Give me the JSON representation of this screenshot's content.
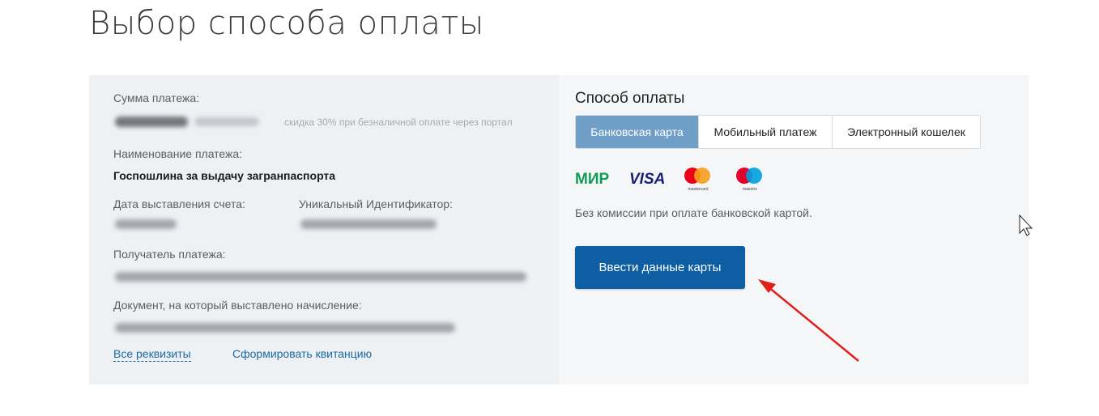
{
  "page": {
    "title": "Выбор способа оплаты"
  },
  "payment_info": {
    "amount_label": "Сумма платежа:",
    "discount_note": "скидка 30% при безналичной оплате через портал",
    "name_label": "Наименование платежа:",
    "name_value": "Госпошлина за выдачу загранпаспорта",
    "date_label": "Дата выставления счета:",
    "uid_label": "Уникальный Идентификатор:",
    "recipient_label": "Получатель платежа:",
    "document_label": "Документ, на который выставлено начисление:",
    "links": {
      "all_details": "Все реквизиты",
      "form_receipt": "Сформировать квитанцию"
    }
  },
  "payment_method": {
    "title": "Способ оплаты",
    "tabs": [
      {
        "label": "Банковская карта",
        "active": true
      },
      {
        "label": "Мобильный платеж",
        "active": false
      },
      {
        "label": "Электронный кошелек",
        "active": false
      }
    ],
    "logos": {
      "mir": "МИР",
      "visa": "VISA",
      "mastercard": "mastercard",
      "maestro": "maestro"
    },
    "no_fee_text": "Без комиссии при оплате банковской картой.",
    "enter_card_button": "Ввести данные карты"
  },
  "colors": {
    "accent_blue": "#0d5ea3",
    "active_tab": "#6f9fc6",
    "link": "#1c6aa3",
    "arrow_red": "#e0201b",
    "mir_green": "#0f9d58",
    "visa_blue": "#1a1f71"
  },
  "icons": [
    "mir-logo-icon",
    "visa-logo-icon",
    "mastercard-logo-icon",
    "maestro-logo-icon",
    "mouse-cursor-icon",
    "red-arrow-annotation-icon"
  ]
}
